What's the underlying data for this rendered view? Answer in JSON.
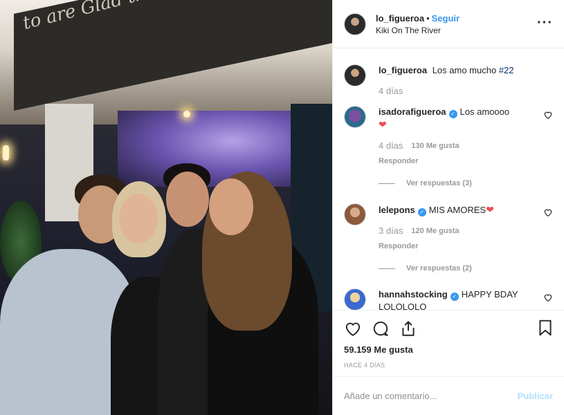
{
  "post": {
    "author": "lo_figueroa",
    "separator": "•",
    "follow_label": "Seguir",
    "location": "Kiki On The River",
    "more_icon": "more-options-icon",
    "image_script": "to are Glad that I'am here to live ["
  },
  "caption": {
    "author": "lo_figueroa",
    "text": "Los amo mucho",
    "hashtag": "#22",
    "time": "4 días"
  },
  "comments": [
    {
      "author": "isadorafigueroa",
      "text": "Los amoooo",
      "emoji": "❤",
      "time": "4 días",
      "likes": "130 Me gusta",
      "reply": "Responder",
      "view_replies": "Ver respuestas (3)"
    },
    {
      "author": "lelepons",
      "text": "MIS AMORES",
      "emoji": "❤",
      "time": "3 días",
      "likes": "120 Me gusta",
      "reply": "Responder",
      "view_replies": "Ver respuestas (2)"
    },
    {
      "author": "hannahstocking",
      "text": "HAPPY BDAY LOLOLOLO"
    }
  ],
  "footer": {
    "likes": "59.159 Me gusta",
    "time": "HACE 4 DÍAS",
    "comment_placeholder": "Añade un comentario...",
    "post_label": "Publicar"
  },
  "colors": {
    "accent": "#3897f0",
    "post_disabled": "#b2dffc",
    "heart": "#ed4956"
  }
}
